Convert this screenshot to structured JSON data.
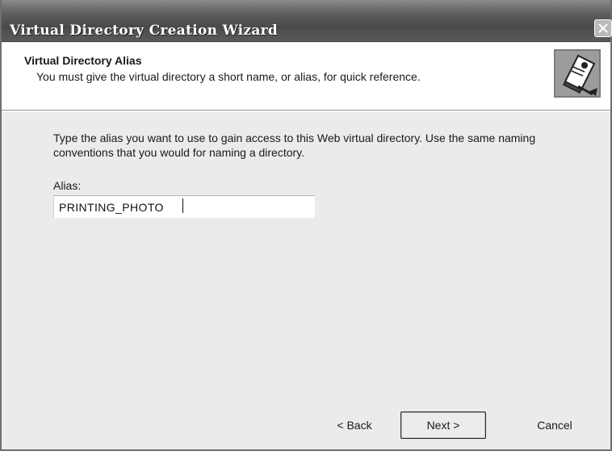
{
  "window": {
    "title": "Virtual Directory Creation Wizard"
  },
  "header": {
    "title": "Virtual Directory Alias",
    "subtitle": "You must give the virtual directory a short name, or alias, for quick reference.",
    "icon": "wizard-book-icon"
  },
  "body": {
    "instructions": "Type the alias you want to use to gain access to this Web virtual directory. Use the same naming conventions that you would for naming a directory.",
    "alias_label": "Alias:",
    "alias_value": "PRINTING_PHOTO"
  },
  "buttons": {
    "back": "< Back",
    "next": "Next >",
    "cancel": "Cancel"
  }
}
